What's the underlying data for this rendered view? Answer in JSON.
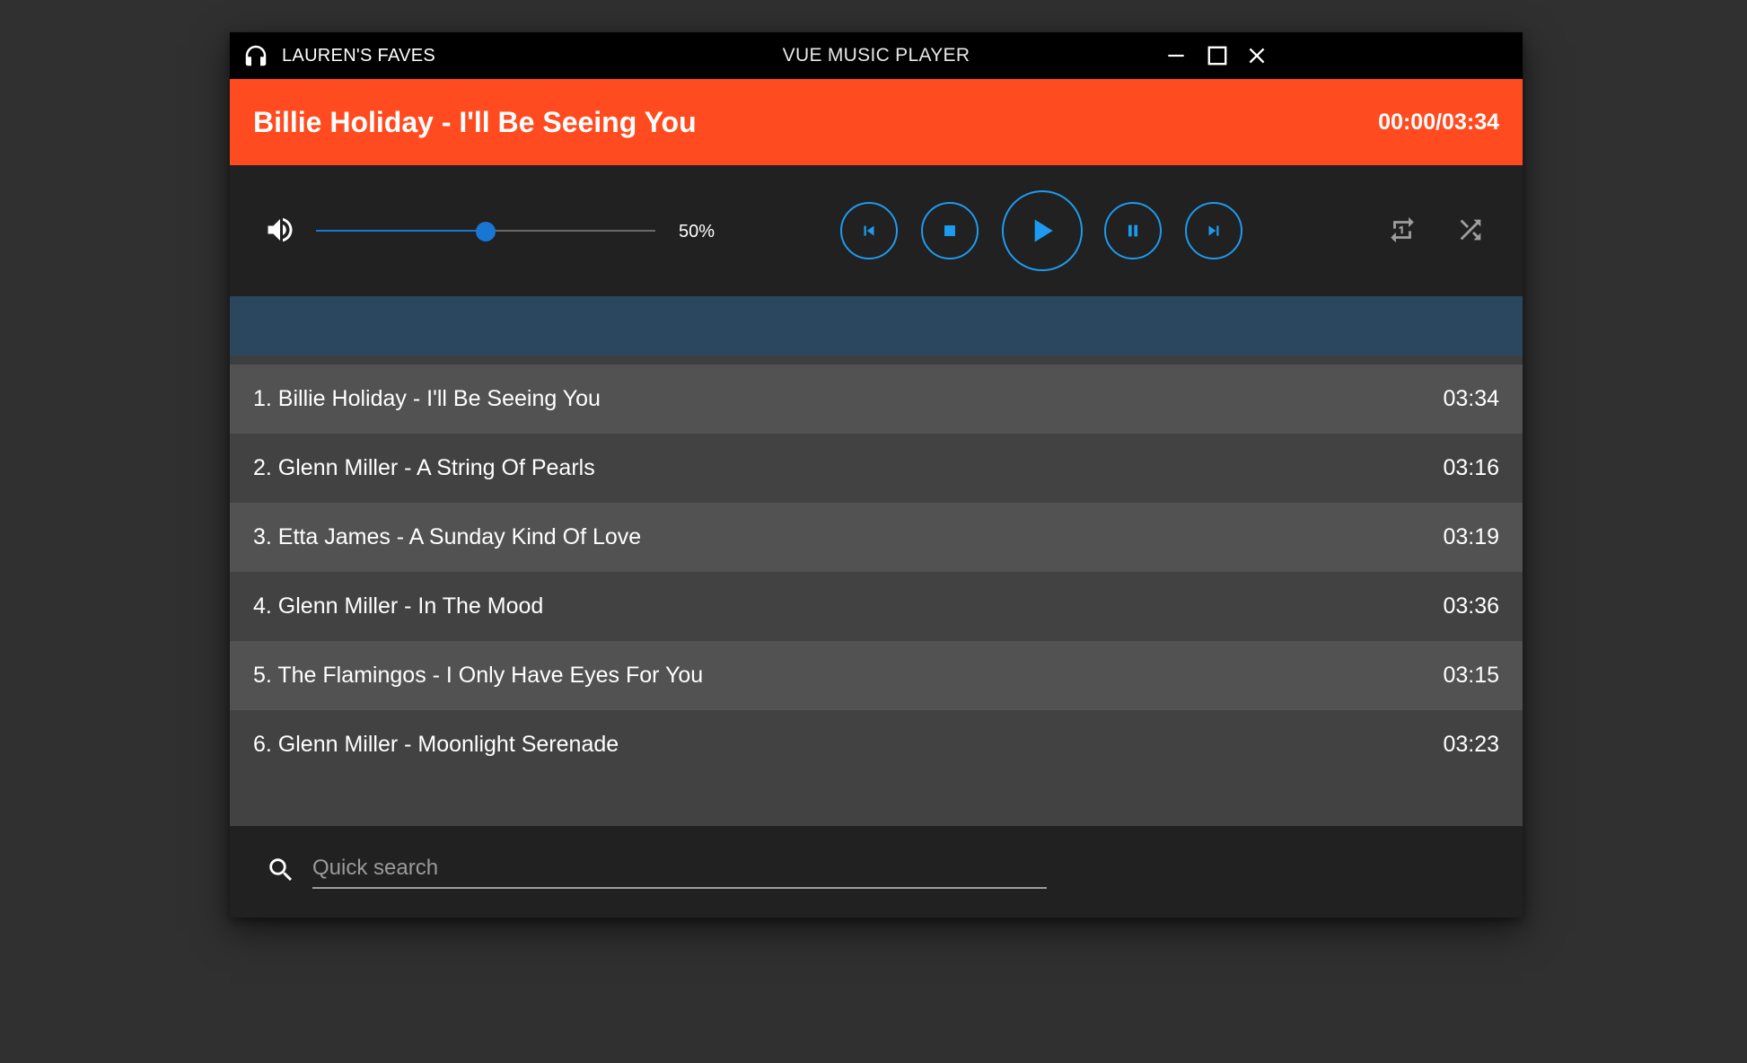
{
  "titlebar": {
    "playlist_name": "LAUREN'S FAVES",
    "app_title": "VUE MUSIC PLAYER",
    "icons": [
      "headphones-icon",
      "minimize-icon",
      "maximize-icon",
      "close-icon"
    ]
  },
  "now_playing": {
    "title": "Billie Holiday - I'll Be Seeing You",
    "time": "00:00/03:34",
    "accent_color": "#ff4b1f"
  },
  "controls": {
    "volume_label": "50%",
    "volume_fraction": 0.5,
    "accent_color": "#1d9bf0",
    "buttons": [
      "skip-previous-icon",
      "stop-icon",
      "play-icon",
      "pause-icon",
      "skip-next-icon"
    ],
    "modes": [
      "repeat-icon",
      "shuffle-icon"
    ]
  },
  "playlist": {
    "header_color": "#2b475f",
    "tracks": [
      {
        "label": "1. Billie Holiday - I'll Be Seeing You",
        "duration": "03:34"
      },
      {
        "label": "2. Glenn Miller - A String Of Pearls",
        "duration": "03:16"
      },
      {
        "label": "3. Etta James - A Sunday Kind Of Love",
        "duration": "03:19"
      },
      {
        "label": "4. Glenn Miller - In The Mood",
        "duration": "03:36"
      },
      {
        "label": "5. The Flamingos - I Only Have Eyes For You",
        "duration": "03:15"
      },
      {
        "label": "6. Glenn Miller - Moonlight Serenade",
        "duration": "03:23"
      }
    ]
  },
  "search": {
    "placeholder": "Quick search",
    "value": ""
  }
}
